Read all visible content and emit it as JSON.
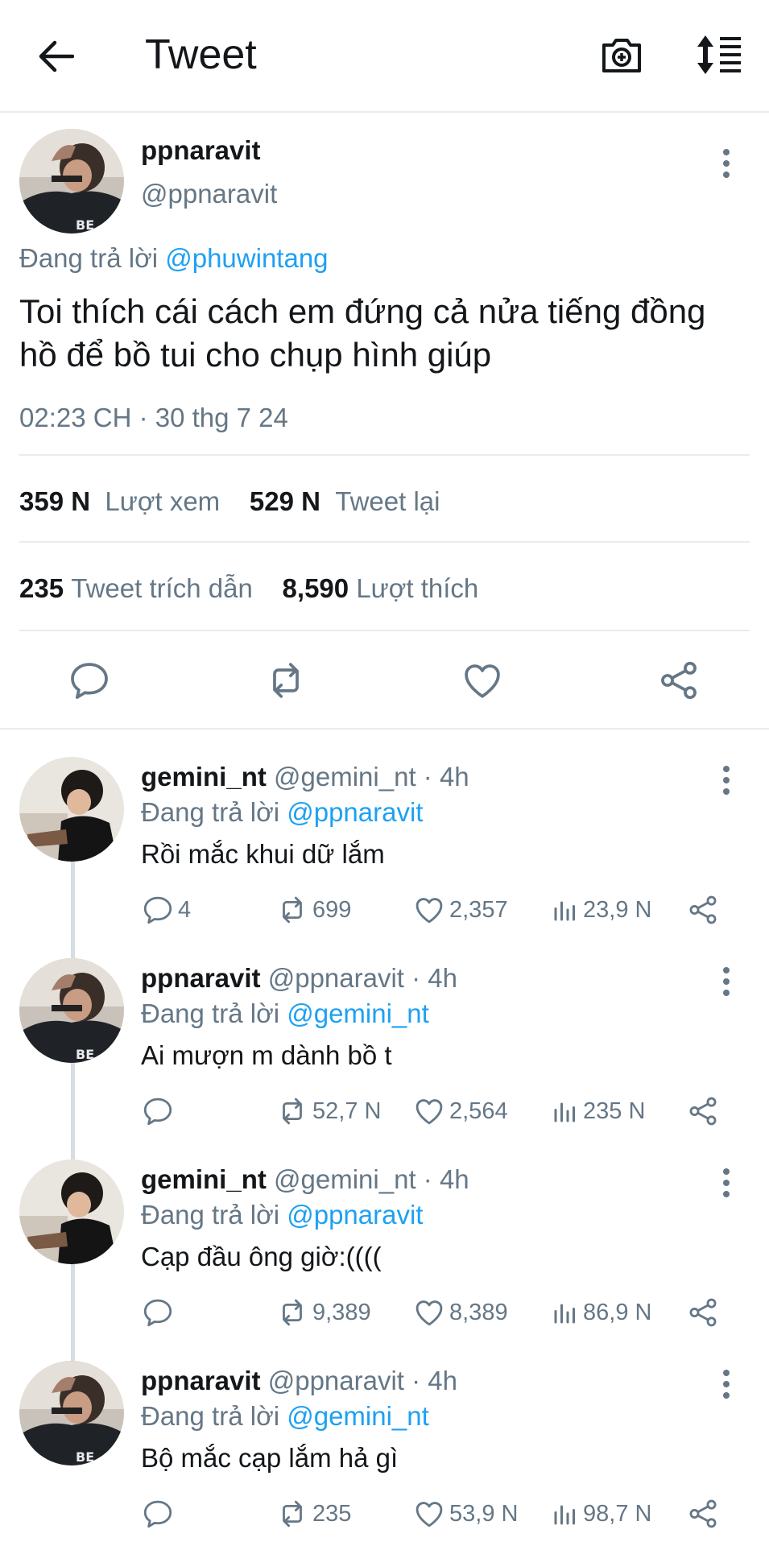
{
  "header": {
    "title": "Tweet"
  },
  "main_tweet": {
    "name": "ppnaravit",
    "handle": "@ppnaravit",
    "reply_prefix": "Đang trả lời ",
    "reply_mention": "@phuwintang",
    "text": "Toi thích cái cách em đứng cả nửa tiếng đồng hồ để bồ tui cho chụp hình giúp",
    "timestamp": "02:23 CH · 30 thg 7 24",
    "views_count": "359 N",
    "views_label": "Lượt xem",
    "retweets_count": "529 N",
    "retweets_label": "Tweet lại",
    "quotes_count": "235",
    "quotes_label": "Tweet trích dẫn",
    "likes_count": "8,590",
    "likes_label": "Lượt thích"
  },
  "replies": [
    {
      "name": "gemini_nt",
      "handle_time": "@gemini_nt · 4h",
      "reply_prefix": "Đang trả lời ",
      "reply_mention": "@ppnaravit",
      "text": "Rồi mắc khui dữ lắm",
      "replies": "4",
      "retweets": "699",
      "likes": "2,357",
      "views": "23,9 N"
    },
    {
      "name": "ppnaravit",
      "handle_time": "@ppnaravit · 4h",
      "reply_prefix": "Đang trả lời ",
      "reply_mention": "@gemini_nt",
      "text": "Ai mượn m dành bồ t",
      "replies": "",
      "retweets": "52,7 N",
      "likes": "2,564",
      "views": "235 N"
    },
    {
      "name": "gemini_nt",
      "handle_time": "@gemini_nt · 4h",
      "reply_prefix": "Đang trả lời ",
      "reply_mention": "@ppnaravit",
      "text": "Cạp đầu ông giờ:((((",
      "replies": "",
      "retweets": "9,389",
      "likes": "8,389",
      "views": "86,9 N"
    },
    {
      "name": "ppnaravit",
      "handle_time": "@ppnaravit · 4h",
      "reply_prefix": "Đang trả lời ",
      "reply_mention": "@gemini_nt",
      "text": "Bộ mắc cạp lắm hả gì",
      "replies": "",
      "retweets": "235",
      "likes": "53,9 N",
      "views": "98,7 N"
    }
  ],
  "icons": {
    "back": "arrow-left-icon",
    "camera": "camera-plus-icon",
    "sort": "sort-icon",
    "more": "more-vertical-icon",
    "reply": "reply-icon",
    "retweet": "retweet-icon",
    "like": "heart-icon",
    "share": "share-icon",
    "views": "views-icon"
  },
  "colors": {
    "link": "#1da1f2",
    "text": "#14171a",
    "secondary": "#657786",
    "divider": "#e6ecf0"
  }
}
